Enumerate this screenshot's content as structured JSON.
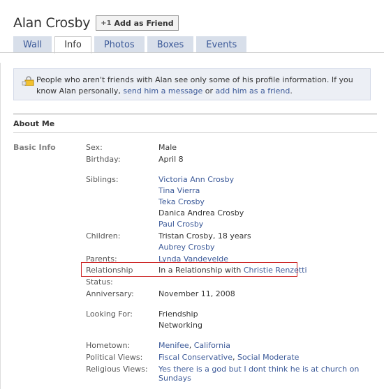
{
  "header": {
    "name": "Alan Crosby",
    "add_friend_plus": "+1",
    "add_friend_label": "Add as Friend"
  },
  "tabs": [
    {
      "label": "Wall"
    },
    {
      "label": "Info",
      "active": true
    },
    {
      "label": "Photos"
    },
    {
      "label": "Boxes"
    },
    {
      "label": "Events"
    }
  ],
  "notice": {
    "text_before": "People who aren't friends with Alan see only some of his profile information. If you know Alan personally, ",
    "link1": "send him a message",
    "mid": " or ",
    "link2": "add him as a friend",
    "end": "."
  },
  "section": {
    "title": "About Me",
    "basic_info_label": "Basic Info"
  },
  "info": {
    "sex_label": "Sex:",
    "sex": "Male",
    "birthday_label": "Birthday:",
    "birthday": "April 8",
    "siblings_label": "Siblings:",
    "siblings": [
      "Victoria Ann Crosby",
      "Tina Vierra",
      "Teka Crosby",
      "Danica Andrea Crosby",
      "Paul Crosby"
    ],
    "children_label": "Children:",
    "children": [
      "Tristan Crosby, 18 years",
      "Aubrey Crosby"
    ],
    "parents_label": "Parents:",
    "parents": "Lynda Vandevelde",
    "relationship_label": "Relationship",
    "relationship_prefix": "In a Relationship with ",
    "relationship_partner": "Christie Renzetti",
    "status_label": "Status:",
    "anniversary_label": "Anniversary:",
    "anniversary": "November 11, 2008",
    "looking_for_label": "Looking For:",
    "looking_for": [
      "Friendship",
      "Networking"
    ],
    "hometown_label": "Hometown:",
    "hometown_city": "Menifee",
    "hometown_sep": ", ",
    "hometown_state": "California",
    "political_label": "Political Views:",
    "political_1": "Fiscal Conservative",
    "political_sep": ", ",
    "political_2": "Social Moderate",
    "religious_label": "Religious Views:",
    "religious": "Yes there is a god but I dont think he is at church on Sundays"
  },
  "colors": {
    "link": "#3b5998",
    "tab_bg": "#d8dfea",
    "notice_bg": "#eceff5",
    "highlight": "#cc2222"
  },
  "icons": {
    "lock": "lock-icon"
  }
}
